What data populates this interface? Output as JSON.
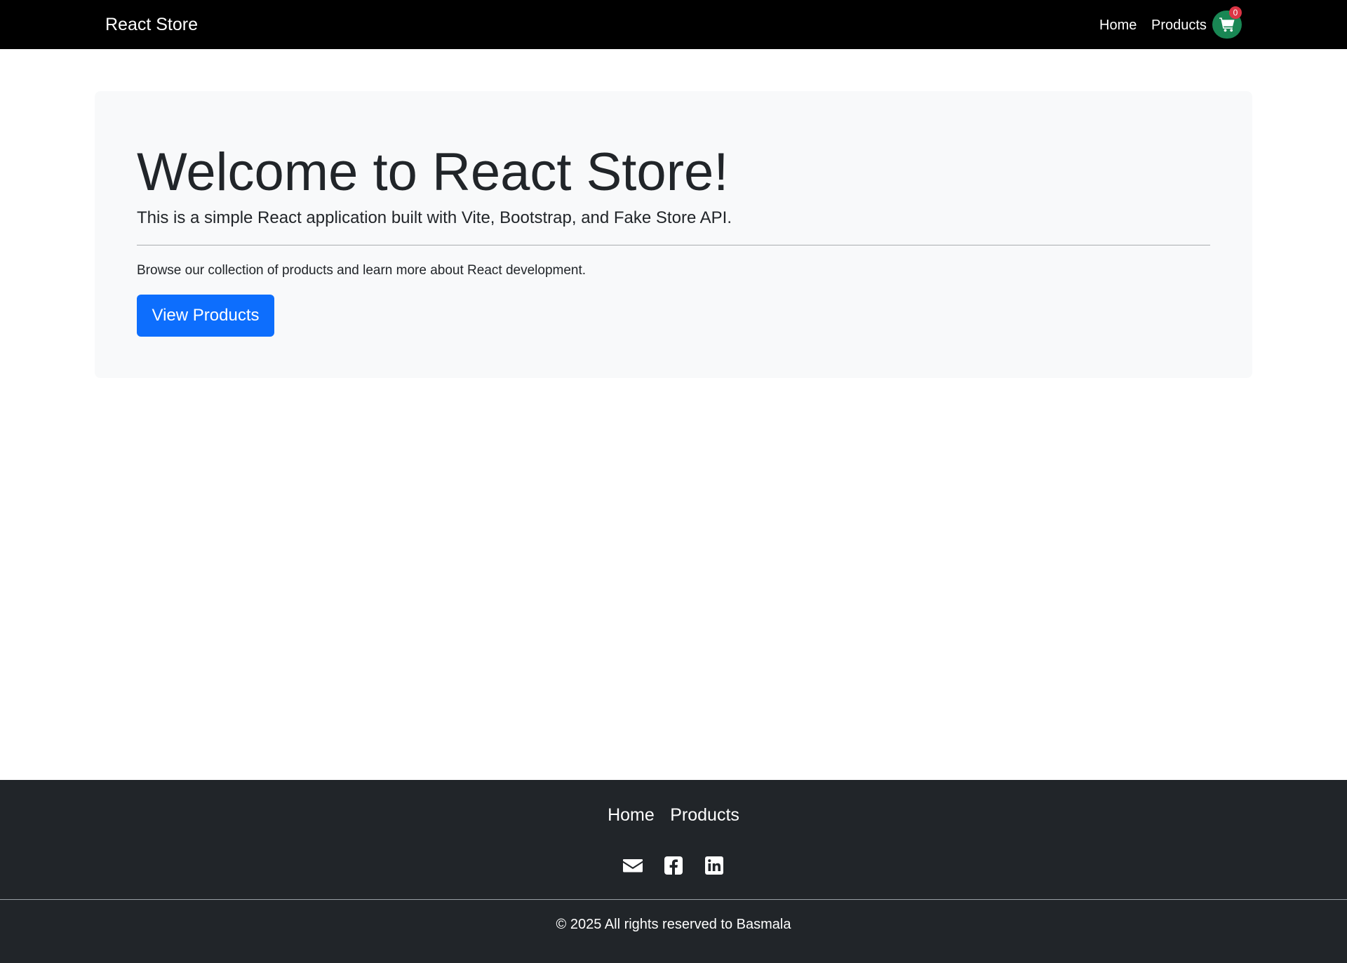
{
  "navbar": {
    "brand": "React Store",
    "links": [
      {
        "label": "Home"
      },
      {
        "label": "Products"
      }
    ],
    "cart": {
      "count": "0",
      "icon": "shopping-cart-icon",
      "color": "#198754",
      "badge_color": "#dc3545"
    }
  },
  "hero": {
    "title": "Welcome to React Store!",
    "lead": "This is a simple React application built with Vite, Bootstrap, and Fake Store API.",
    "text": "Browse our collection of products and learn more about React development.",
    "button_label": "View Products",
    "button_color": "#0d6efd"
  },
  "footer": {
    "links": [
      {
        "label": "Home"
      },
      {
        "label": "Products"
      }
    ],
    "social_icons": [
      "envelope-icon",
      "facebook-icon",
      "linkedin-icon"
    ],
    "copyright": "© 2025 All rights reserved to Basmala",
    "background": "#212529"
  }
}
